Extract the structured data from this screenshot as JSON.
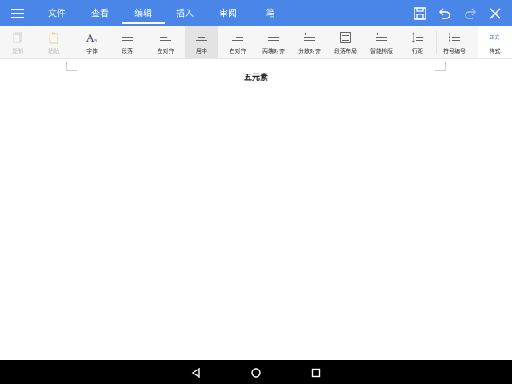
{
  "menu": {
    "tabs": [
      {
        "label": "文件"
      },
      {
        "label": "查看"
      },
      {
        "label": "编辑"
      },
      {
        "label": "插入"
      },
      {
        "label": "审阅"
      },
      {
        "label": "笔"
      }
    ],
    "active_tab": "编辑"
  },
  "ribbon": {
    "items": [
      {
        "label": "复制",
        "icon": "copy-icon",
        "state": "disabled"
      },
      {
        "label": "粘贴",
        "icon": "paste-icon",
        "state": "disabled"
      },
      {
        "label": "字体",
        "icon": "font-icon"
      },
      {
        "label": "段落",
        "icon": "paragraph-icon"
      },
      {
        "label": "左对齐",
        "icon": "align-left-icon"
      },
      {
        "label": "居中",
        "icon": "align-center-icon",
        "state": "selected"
      },
      {
        "label": "右对齐",
        "icon": "align-right-icon"
      },
      {
        "label": "两端对齐",
        "icon": "justify-icon"
      },
      {
        "label": "分散对齐",
        "icon": "distributed-icon"
      },
      {
        "label": "段落布局",
        "icon": "paragraph-layout-icon"
      },
      {
        "label": "智能排版",
        "icon": "smart-layout-icon"
      },
      {
        "label": "行距",
        "icon": "line-spacing-icon"
      },
      {
        "label": "符号编号",
        "icon": "bullets-icon"
      }
    ],
    "style": {
      "preview": "正文",
      "label": "样式"
    }
  },
  "document": {
    "title": "五元素"
  },
  "colors": {
    "accent": "#4a86e8",
    "style_preview": "#2b6cd6"
  }
}
